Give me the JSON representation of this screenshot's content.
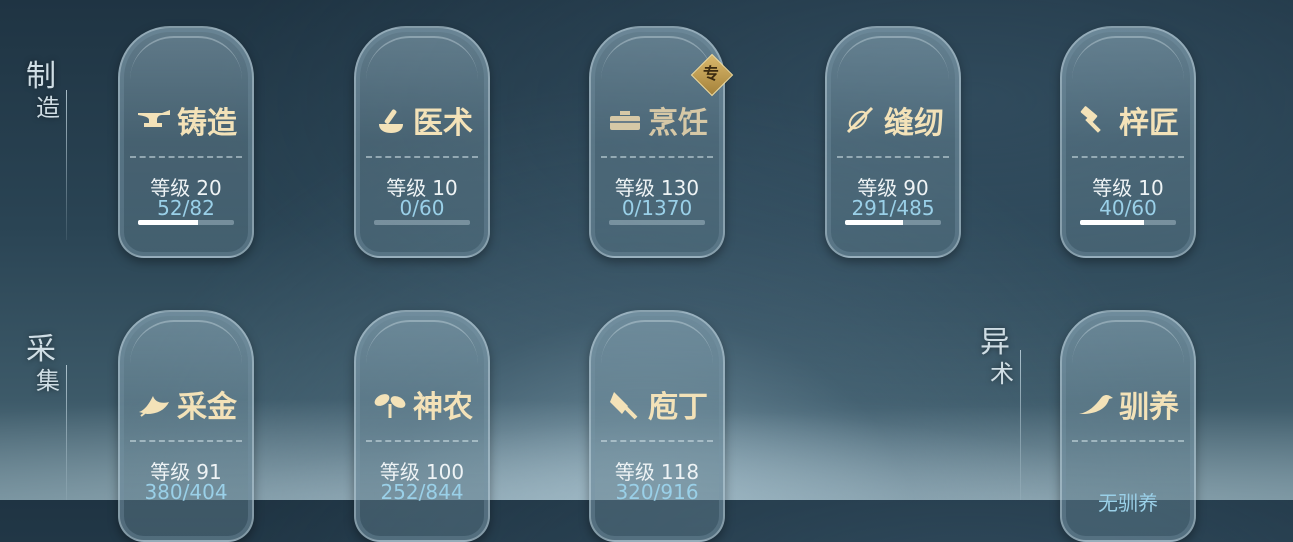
{
  "sections": {
    "crafting": {
      "char1": "制",
      "char2": "造"
    },
    "gathering": {
      "char1": "采",
      "char2": "集"
    },
    "special": {
      "char1": "异",
      "char2": "术"
    }
  },
  "level_label": "等级",
  "cards": {
    "forging": {
      "name": "铸造",
      "level": "20",
      "exp": "52/82",
      "progress": 0.63,
      "icon": "anvil-icon"
    },
    "medicine": {
      "name": "医术",
      "level": "10",
      "exp": "0/60",
      "progress": 0.0,
      "icon": "mortar-pestle-icon"
    },
    "cooking": {
      "name": "烹饪",
      "level": "130",
      "exp": "0/1370",
      "progress": 0.0,
      "icon": "cookware-icon",
      "badge": "专"
    },
    "sewing": {
      "name": "缝纫",
      "level": "90",
      "exp": "291/485",
      "progress": 0.6,
      "icon": "needle-icon"
    },
    "carpentry": {
      "name": "梓匠",
      "level": "10",
      "exp": "40/60",
      "progress": 0.67,
      "icon": "hammer-icon"
    },
    "gold": {
      "name": "采金",
      "level": "91",
      "exp": "380/404",
      "icon": "leaf-icon"
    },
    "herbalism": {
      "name": "神农",
      "level": "100",
      "exp": "252/844",
      "icon": "sprout-icon"
    },
    "butcher": {
      "name": "庖丁",
      "level": "118",
      "exp": "320/916",
      "icon": "cleaver-icon"
    },
    "taming": {
      "name": "驯养",
      "status": "无驯养",
      "icon": "bird-icon"
    }
  },
  "colors": {
    "title": "#f3e2b8",
    "exp": "#9ad0e8",
    "badge": "#c9a458"
  }
}
